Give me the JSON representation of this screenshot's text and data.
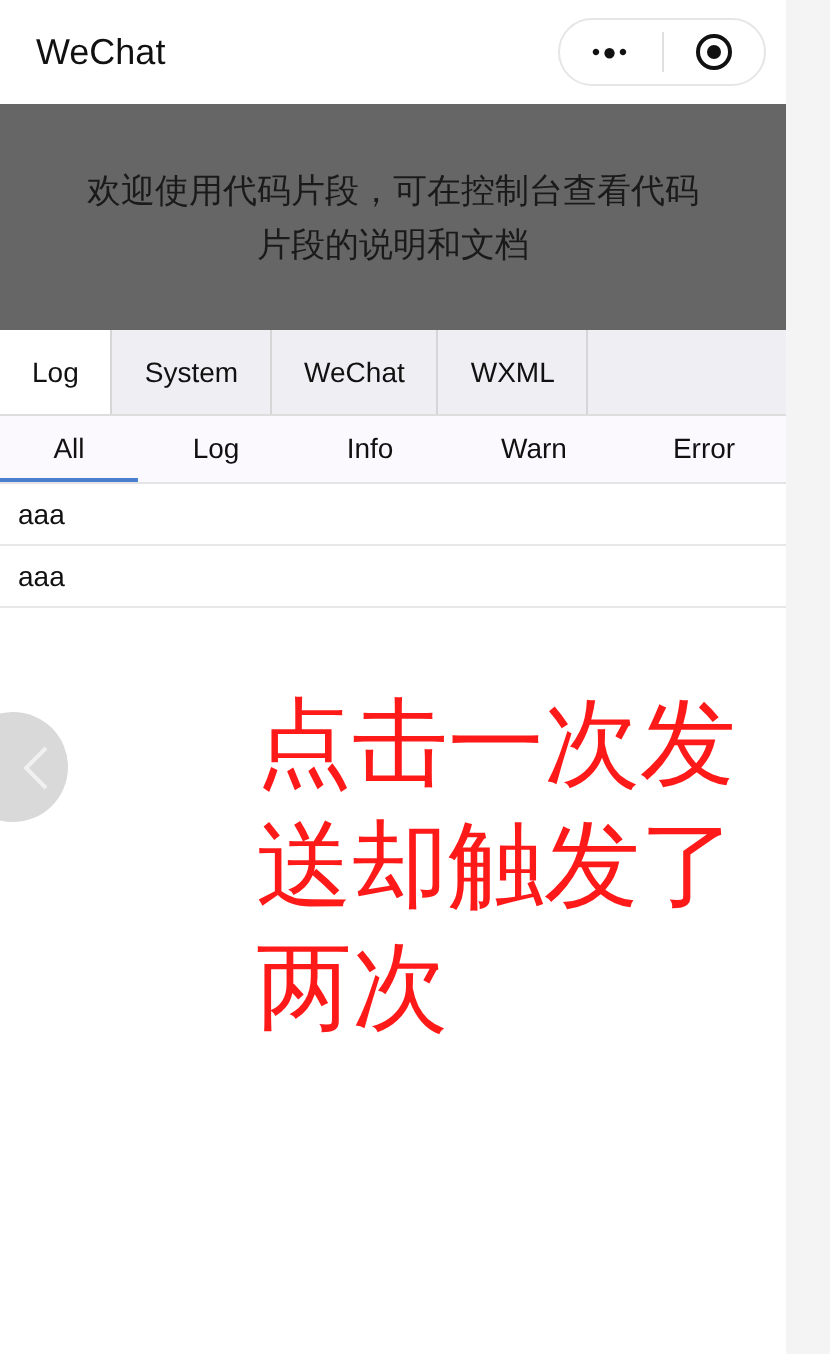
{
  "nav": {
    "title": "WeChat",
    "menu_glyph": "•●•"
  },
  "banner": {
    "text": "欢迎使用代码片段，可在控制台查看代码片段的说明和文档"
  },
  "tabs": [
    {
      "label": "Log",
      "selected": true
    },
    {
      "label": "System",
      "selected": false
    },
    {
      "label": "WeChat",
      "selected": false
    },
    {
      "label": "WXML",
      "selected": false
    }
  ],
  "filters": [
    {
      "label": "All",
      "selected": true
    },
    {
      "label": "Log",
      "selected": false
    },
    {
      "label": "Info",
      "selected": false
    },
    {
      "label": "Warn",
      "selected": false
    },
    {
      "label": "Error",
      "selected": false
    }
  ],
  "log_rows": [
    "aaa",
    "aaa"
  ],
  "annotation": "点击一次发送却触发了两次"
}
